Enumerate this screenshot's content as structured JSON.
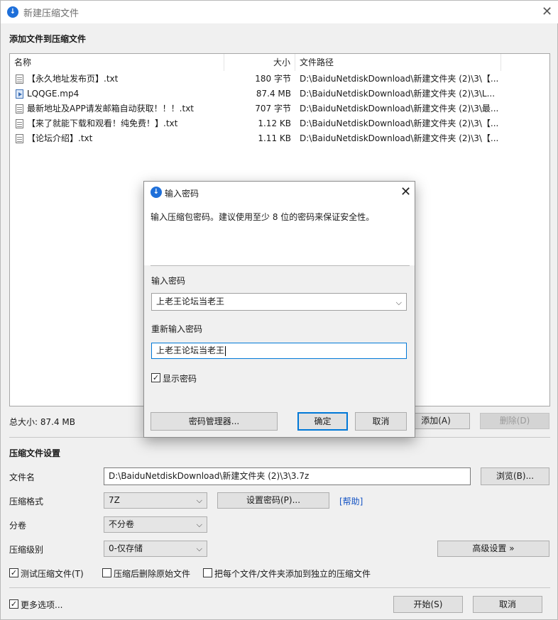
{
  "window": {
    "title": "新建压缩文件"
  },
  "add_section_title": "添加文件到压缩文件",
  "list": {
    "headers": {
      "name": "名称",
      "size": "大小",
      "path": "文件路径"
    },
    "rows": [
      {
        "icon": "text-file-icon",
        "name": "【永久地址发布页】.txt",
        "size": "180 字节",
        "path": "D:\\BaiduNetdiskDownload\\新建文件夹 (2)\\3\\【..."
      },
      {
        "icon": "video-file-icon",
        "name": "LQQGE.mp4",
        "size": "87.4 MB",
        "path": "D:\\BaiduNetdiskDownload\\新建文件夹 (2)\\3\\L..."
      },
      {
        "icon": "text-file-icon",
        "name": "最新地址及APP请发邮箱自动获取！！！.txt",
        "size": "707 字节",
        "path": "D:\\BaiduNetdiskDownload\\新建文件夹 (2)\\3\\最..."
      },
      {
        "icon": "text-file-icon",
        "name": "【来了就能下载和观看！纯免费！】.txt",
        "size": "1.12 KB",
        "path": "D:\\BaiduNetdiskDownload\\新建文件夹 (2)\\3\\【..."
      },
      {
        "icon": "text-file-icon",
        "name": "【论坛介绍】.txt",
        "size": "1.11 KB",
        "path": "D:\\BaiduNetdiskDownload\\新建文件夹 (2)\\3\\【..."
      }
    ]
  },
  "total_size": "总大小: 87.4 MB",
  "buttons": {
    "add": "添加(A)",
    "delete": "删除(D)",
    "browse": "浏览(B)...",
    "set_password": "设置密码(P)...",
    "help": "[帮助]",
    "advanced": "高级设置 »",
    "start": "开始(S)",
    "cancel": "取消"
  },
  "settings": {
    "title": "压缩文件设置",
    "filename_label": "文件名",
    "filename_value": "D:\\BaiduNetdiskDownload\\新建文件夹 (2)\\3\\3.7z",
    "format_label": "压缩格式",
    "format_value": "7Z",
    "split_label": "分卷",
    "split_value": "不分卷",
    "level_label": "压缩级别",
    "level_value": "0-仅存储"
  },
  "options": {
    "test": {
      "label": "测试压缩文件(T)",
      "checked": true
    },
    "delete_after": {
      "label": "压缩后删除原始文件",
      "checked": false
    },
    "separate": {
      "label": "把每个文件/文件夹添加到独立的压缩文件",
      "checked": false
    },
    "more": {
      "label": "更多选项...",
      "checked": true
    }
  },
  "dialog": {
    "title": "输入密码",
    "description": "输入压缩包密码。建议使用至少 8 位的密码来保证安全性。",
    "password_label": "输入密码",
    "password_value": "上老王论坛当老王",
    "confirm_label": "重新输入密码",
    "confirm_value": "上老王论坛当老王",
    "show_password": {
      "label": "显示密码",
      "checked": true
    },
    "manager_button": "密码管理器...",
    "ok_button": "确定",
    "cancel_button": "取消"
  },
  "colors": {
    "accent": "#0078d7",
    "app_icon": "#1e6fd9",
    "link": "#1554c4"
  }
}
